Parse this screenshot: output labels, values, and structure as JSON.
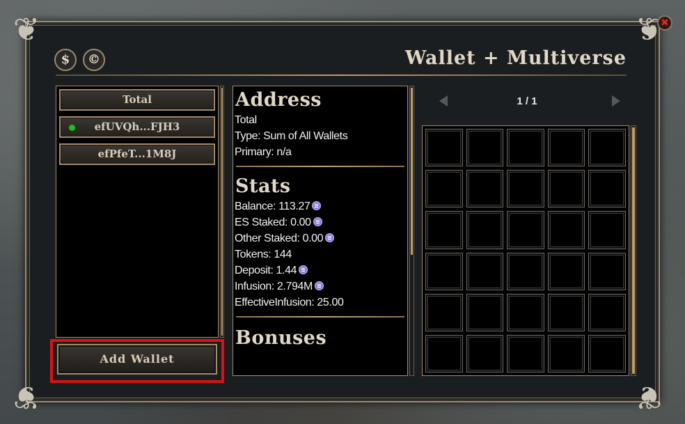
{
  "header": {
    "title": "Wallet + Multiverse",
    "currency_buttons": [
      {
        "glyph": "$",
        "icon": "dollar-currency-icon"
      },
      {
        "glyph": "©",
        "icon": "copyright-currency-icon"
      }
    ],
    "close_glyph": "✖"
  },
  "wallets": {
    "items": [
      {
        "label": "Total",
        "active": false
      },
      {
        "label": "efUVQh...FJH3",
        "active": true
      },
      {
        "label": "efPfeT...1M8J",
        "active": false
      }
    ],
    "add_label": "Add Wallet"
  },
  "details": {
    "address": {
      "heading": "Address",
      "lines": [
        "Total",
        "Type: Sum of All Wallets",
        "Primary: n/a"
      ]
    },
    "stats": {
      "heading": "Stats",
      "lines": [
        {
          "text": "Balance: 113.27",
          "coin": true
        },
        {
          "text": "ES Staked: 0.00",
          "coin": true
        },
        {
          "text": "Other Staked: 0.00",
          "coin": true
        },
        {
          "text": "Tokens: 144",
          "coin": false
        },
        {
          "text": "Deposit: 1.44",
          "coin": true
        },
        {
          "text": "Infusion: 2.794M",
          "coin": true
        },
        {
          "text": "EffectiveInfusion: 25.00",
          "coin": false
        }
      ]
    },
    "bonuses": {
      "heading": "Bonuses"
    }
  },
  "inventory": {
    "page": "1 / 1",
    "slot_count": 30
  },
  "colors": {
    "accent_gold": "#a48c6a",
    "active_dot": "#19c219",
    "highlight": "#e01010",
    "coin": "#8d7fe0"
  }
}
